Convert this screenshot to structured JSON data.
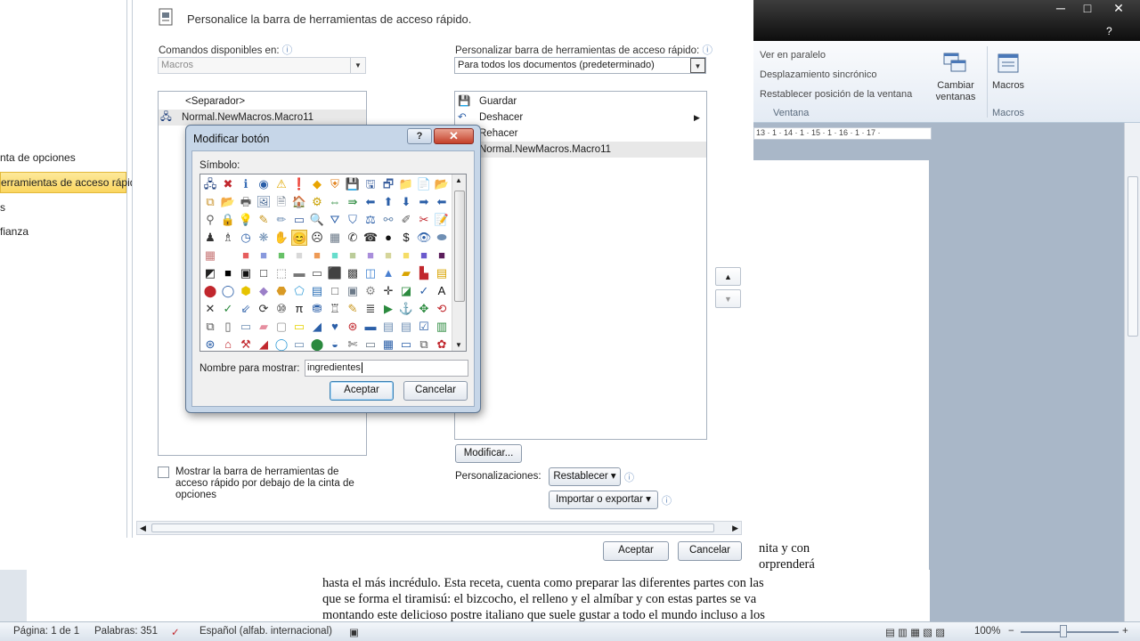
{
  "word_window": {
    "window_buttons": [
      "─",
      "□",
      "✕"
    ],
    "ribbon_help": "?",
    "ribbon": {
      "window_group": {
        "items": [
          "Ver en paralelo",
          "Desplazamiento sincrónico",
          "Restablecer posición de la ventana"
        ],
        "switch_windows_label": "Cambiar ventanas",
        "label": "Ventana"
      },
      "macros_group": {
        "button_label": "Macros",
        "label": "Macros"
      }
    },
    "ruler": "13 · 1 · 14 · 1 · 15 · 1 · 16 · 1 · 17 ·",
    "document_lines": [
      "nita y con",
      "orprenderá",
      "hasta el más incrédulo. Esta receta, cuenta como preparar las diferentes partes con las",
      "que se forma el tiramisú: el bizcocho, el relleno y el almíbar y con estas partes se va",
      "montando este delicioso postre italiano que suele gustar a todo el mundo incluso a los"
    ]
  },
  "status_bar": {
    "page": "Página: 1 de 1",
    "words": "Palabras: 351",
    "language": "Español (alfab. internacional)",
    "zoom": "100%"
  },
  "options_dialog": {
    "nav_items": [
      {
        "label": "nta de opciones",
        "selected": false
      },
      {
        "label": "erramientas de acceso rápido",
        "selected": true
      },
      {
        "label": "s",
        "selected": false
      },
      {
        "label": "fianza",
        "selected": false
      }
    ],
    "heading": "Personalice la barra de herramientas de acceso rápido.",
    "commands_label": "Comandos disponibles en:",
    "commands_value": "Macros",
    "customize_label": "Personalizar barra de herramientas de acceso rápido:",
    "customize_value": "Para todos los documentos (predeterminado)",
    "available_items": [
      "<Separador>",
      "Normal.NewMacros.Macro11"
    ],
    "toolbar_items": [
      "Guardar",
      "Deshacer",
      "Rehacer",
      "Normal.NewMacros.Macro11"
    ],
    "modify_button": "Modificar...",
    "customizations_label": "Personalizaciones:",
    "reset_button": "Restablecer ▾",
    "import_export_button": "Importar o exportar ▾",
    "show_below_checkbox": "Mostrar la barra de herramientas de acceso rápido por debajo de la cinta de opciones",
    "ok_button": "Aceptar",
    "cancel_button": "Cancelar"
  },
  "modify_dialog": {
    "title": "Modificar botón",
    "help": "?",
    "close": "✕",
    "symbol_label": "Símbolo:",
    "symbols": [
      "🖧",
      "✖",
      "ℹ",
      "◉",
      "⚠",
      "❗",
      "◆",
      "⛨",
      "💾",
      "🖫",
      "🗗",
      "📁",
      "📄",
      "📂",
      "⧉",
      "📂",
      "🖶",
      "🖼",
      "🗎",
      "🏠",
      "⚙",
      "⇔",
      "⇛",
      "⬅",
      "⬆",
      "⬇",
      "➡",
      "⬅",
      "⚲",
      "🔒",
      "💡",
      "✎",
      "✏",
      "▭",
      "🔍",
      "⛛",
      "⛉",
      "⚖",
      "⚯",
      "✐",
      "✂",
      "📝",
      "♟",
      "♗",
      "◷",
      "❋",
      "✋",
      "😊",
      "☹",
      "▦",
      "✆",
      "☎",
      "●",
      "$",
      "👁",
      "⬬",
      "▦",
      "□",
      "■",
      "■",
      "■",
      "■",
      "■",
      "■",
      "■",
      "■",
      "■",
      "■",
      "■",
      "■",
      "◩",
      "■",
      "▣",
      "□",
      "⬚",
      "▬",
      "▭",
      "⬛",
      "▩",
      "◫",
      "▲",
      "▰",
      "▙",
      "▤",
      "⬤",
      "◯",
      "⬢",
      "◆",
      "⬣",
      "⬠",
      "▤",
      "□",
      "▣",
      "⚙",
      "✛",
      "◪",
      "✓",
      "A",
      "✕",
      "✓",
      "⇙",
      "⟳",
      "⑩",
      "π",
      "⛃",
      "♖",
      "✎",
      "≣",
      "▶",
      "⚓",
      "✥",
      "⟲",
      "⧉",
      "▯",
      "▭",
      "▰",
      "▢",
      "▭",
      "◢",
      "♥",
      "⊛",
      "▬",
      "▤",
      "▤",
      "☑",
      "▥",
      "⊛",
      "⌂",
      "⚒",
      "◢",
      "◯",
      "▭",
      "⬤",
      "◒",
      "✄",
      "▭",
      "▦",
      "▭",
      "⧉",
      "✿"
    ],
    "symbol_colors": [
      "#1c3d7a",
      "#c1272d",
      "#3a6fb6",
      "#2b5fa8",
      "#e0a800",
      "#c1272d",
      "#e8a400",
      "#e07b10",
      "#2d4e8c",
      "#3a5f9e",
      "#3a5f9e",
      "#e6b530",
      "#6c7a89",
      "#e6b530",
      "#c89128",
      "#d99a25",
      "#5b5b5b",
      "#4a6b96",
      "#6c7a89",
      "#7a4b22",
      "#c8a000",
      "#2b8a3e",
      "#2b8a3e",
      "#2b5fa8",
      "#2b5fa8",
      "#2b5fa8",
      "#2b5fa8",
      "#2b5fa8",
      "#5b5b5b",
      "#c8961e",
      "#e6c300",
      "#c8961e",
      "#6f8fb4",
      "#3a5f9e",
      "#4a4a4a",
      "#2b5fa8",
      "#2b5fa8",
      "#2b5fa8",
      "#6f8fb4",
      "#5b5b5b",
      "#c1272d",
      "#c1272d",
      "#333333",
      "#333333",
      "#2b5fa8",
      "#6f8fb4",
      "#d9a400",
      "#1a1a1a",
      "#1a1a1a",
      "#6c7a89",
      "#333333",
      "#333333",
      "#111111",
      "#111111",
      "#2b5fa8",
      "#6f8fb4",
      "#c97a7a",
      "#ffffff",
      "#e65d5d",
      "#8899dd",
      "#67c167",
      "#d8d8d8",
      "#ee9a55",
      "#66ddcc",
      "#bbcc99",
      "#a98edb",
      "#d5d59a",
      "#f5dd66",
      "#6a5acd",
      "#5b1d5b",
      "#222222",
      "#000000",
      "#111111",
      "#111111",
      "#888888",
      "#777777",
      "#555555",
      "#111111",
      "#444444",
      "#3a7fd0",
      "#4a7fd0",
      "#d9a400",
      "#c1272d",
      "#d9a400",
      "#c1272d",
      "#2b5fa8",
      "#e6c300",
      "#9b7fc8",
      "#d99a25",
      "#3a9fd8",
      "#2b6fb6",
      "#555555",
      "#6c7a89",
      "#888888",
      "#333333",
      "#2b8a3e",
      "#2b5fa8",
      "#111111",
      "#333333",
      "#2b8a3e",
      "#2b5fa8",
      "#333333",
      "#333333",
      "#111111",
      "#2b5fa8",
      "#333333",
      "#c8961e",
      "#333333",
      "#2b8a3e",
      "#2b5fa8",
      "#2b8a3e",
      "#c1272d",
      "#555555",
      "#555555",
      "#6f8fb4",
      "#e68fa0",
      "#999999",
      "#e6d300",
      "#2b5fa8",
      "#2b5fa8",
      "#c1272d",
      "#2b5fa8",
      "#6f8fb4",
      "#6f8fb4",
      "#2b5fa8",
      "#2b8a3e",
      "#2b5fa8",
      "#c1272d",
      "#c1272d",
      "#c1272d",
      "#3a9fd8",
      "#6f8fb4",
      "#2b8a3e",
      "#2b5fa8",
      "#555555",
      "#6c7a89",
      "#2b5fa8",
      "#2b5fa8",
      "#555555",
      "#c1272d"
    ],
    "selected_symbol_index": 47,
    "name_label": "Nombre para mostrar:",
    "name_value": "ingredientes",
    "ok_button": "Aceptar",
    "cancel_button": "Cancelar"
  }
}
